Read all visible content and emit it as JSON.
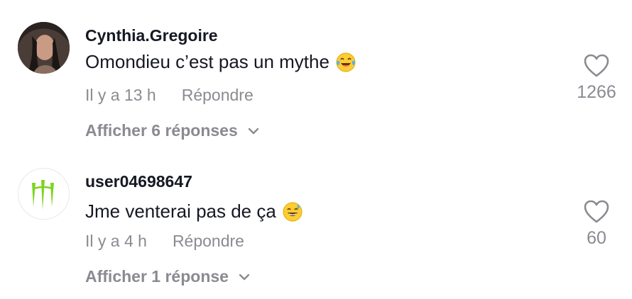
{
  "comments": [
    {
      "username": "Cynthia.Gregoire",
      "text": "Omondieu c’est pas un mythe",
      "emoji": "laughing-tears-emoji",
      "time": "Il y a 13 h",
      "reply_label": "Répondre",
      "view_replies": "Afficher 6 réponses",
      "likes": "1266"
    },
    {
      "username": "user04698647",
      "text": "Jme venterai pas de ça",
      "emoji": "sweat-smile-emoji",
      "time": "Il y a 4 h",
      "reply_label": "Répondre",
      "view_replies": "Afficher 1 réponse",
      "likes": "60"
    }
  ],
  "colors": {
    "primary_text": "#161823",
    "secondary_text": "#8a8b91",
    "monster_green": "#7ed321"
  }
}
